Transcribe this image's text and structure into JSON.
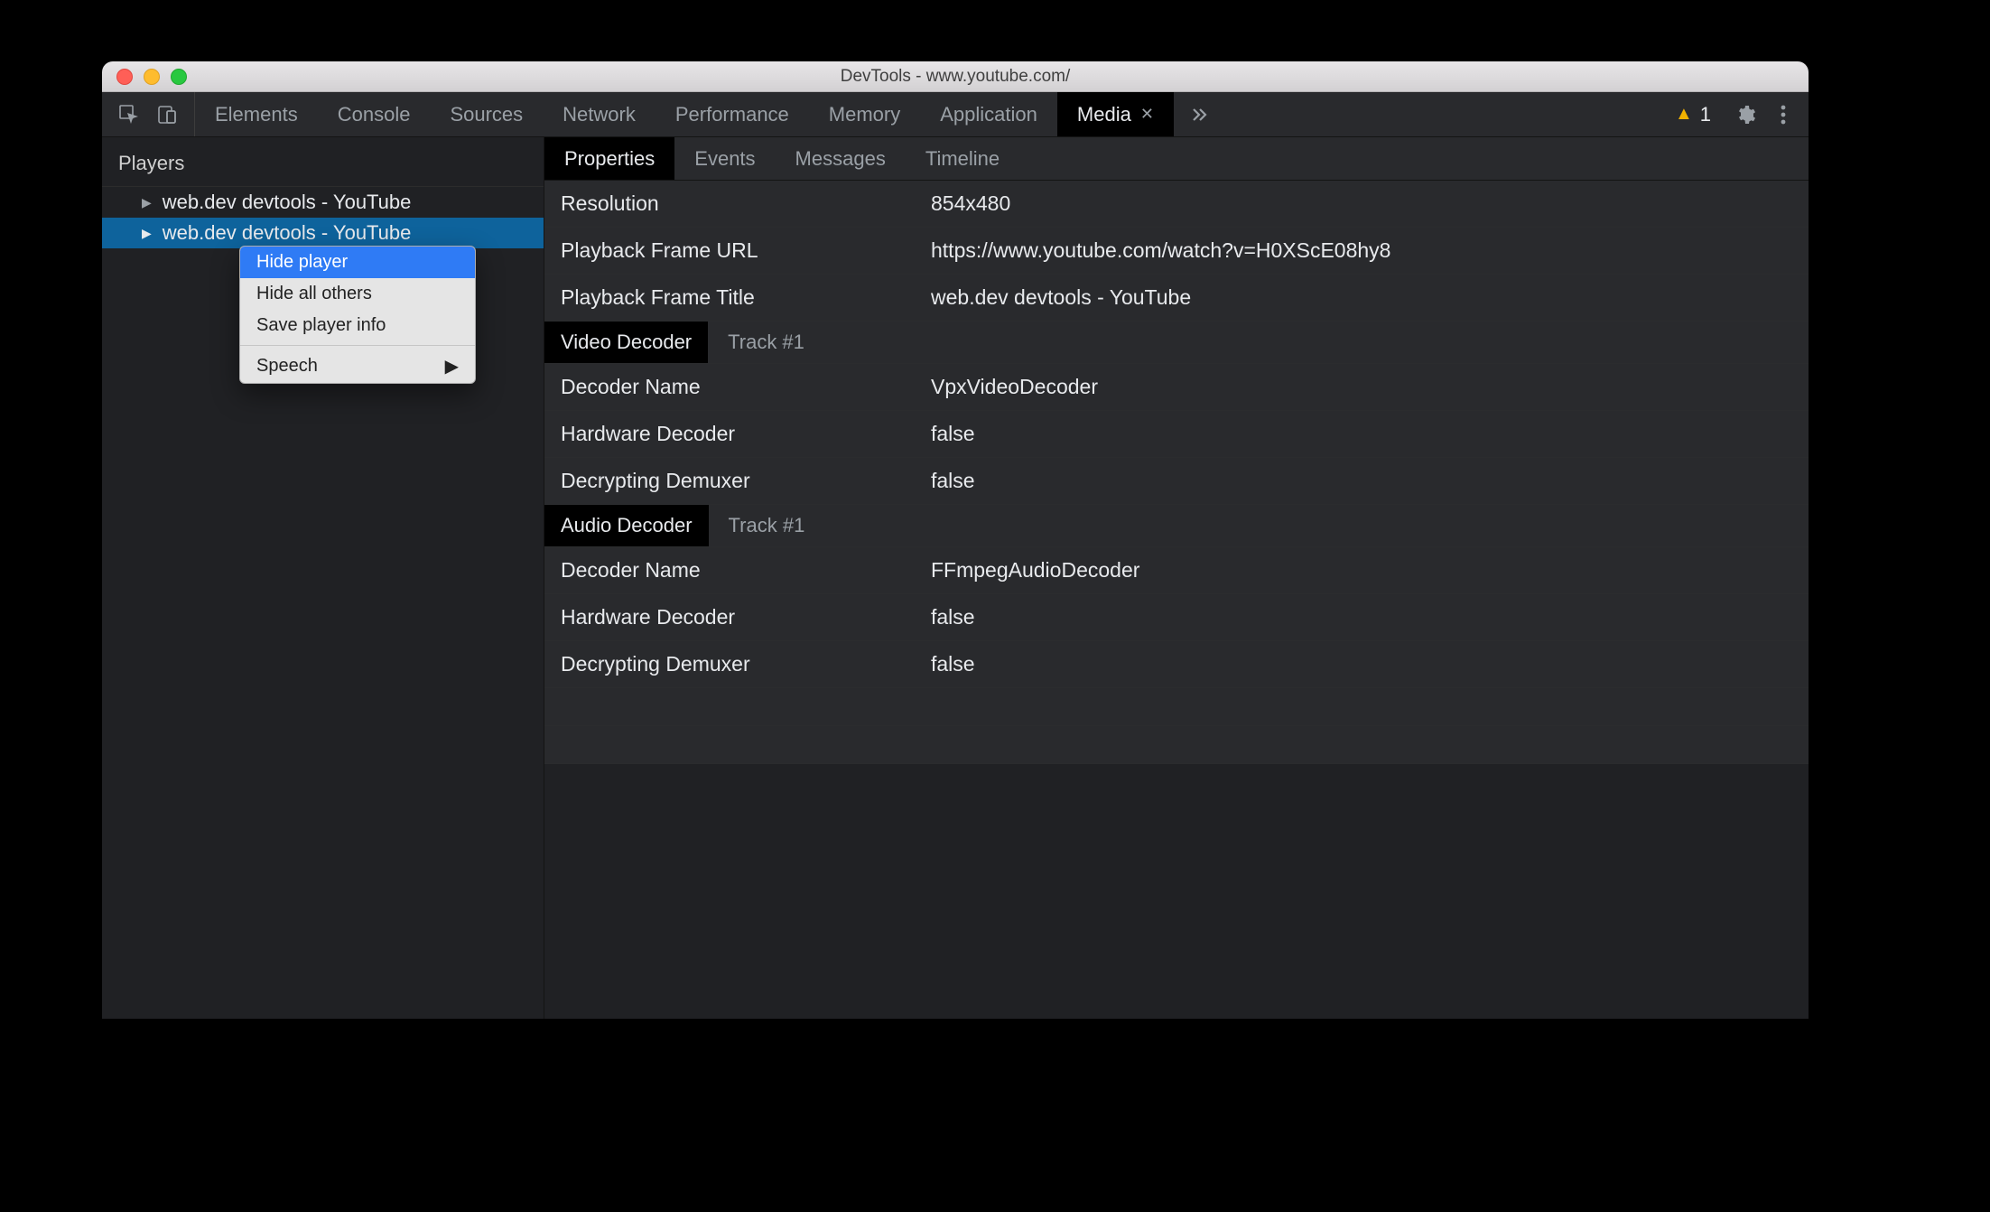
{
  "window": {
    "title": "DevTools - www.youtube.com/"
  },
  "toolbar": {
    "tabs": [
      "Elements",
      "Console",
      "Sources",
      "Network",
      "Performance",
      "Memory",
      "Application",
      "Media"
    ],
    "active_tab": "Media",
    "warning_count": "1"
  },
  "sidebar": {
    "header": "Players",
    "players": [
      {
        "label": "web.dev devtools - YouTube",
        "selected": false
      },
      {
        "label": "web.dev devtools - YouTube",
        "selected": true
      }
    ]
  },
  "context_menu": {
    "items": [
      {
        "label": "Hide player",
        "hover": true
      },
      {
        "label": "Hide all others",
        "hover": false
      },
      {
        "label": "Save player info",
        "hover": false
      }
    ],
    "submenu": {
      "label": "Speech"
    }
  },
  "subtabs": {
    "items": [
      "Properties",
      "Events",
      "Messages",
      "Timeline"
    ],
    "active": "Properties"
  },
  "properties": {
    "general": [
      {
        "label": "Resolution",
        "value": "854x480"
      },
      {
        "label": "Playback Frame URL",
        "value": "https://www.youtube.com/watch?v=H0XScE08hy8"
      },
      {
        "label": "Playback Frame Title",
        "value": "web.dev devtools - YouTube"
      }
    ],
    "video_decoder": {
      "heading": "Video Decoder",
      "track": "Track #1",
      "rows": [
        {
          "label": "Decoder Name",
          "value": "VpxVideoDecoder"
        },
        {
          "label": "Hardware Decoder",
          "value": "false"
        },
        {
          "label": "Decrypting Demuxer",
          "value": "false"
        }
      ]
    },
    "audio_decoder": {
      "heading": "Audio Decoder",
      "track": "Track #1",
      "rows": [
        {
          "label": "Decoder Name",
          "value": "FFmpegAudioDecoder"
        },
        {
          "label": "Hardware Decoder",
          "value": "false"
        },
        {
          "label": "Decrypting Demuxer",
          "value": "false"
        }
      ]
    }
  }
}
